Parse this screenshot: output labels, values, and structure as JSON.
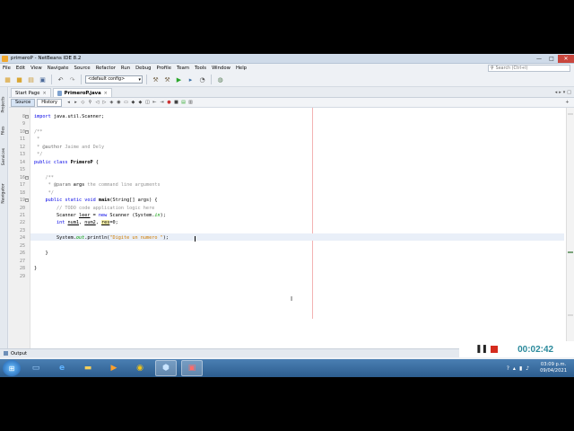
{
  "window": {
    "title": "primeroP - NetBeans IDE 8.2",
    "controls": [
      "—",
      "□",
      "✕"
    ]
  },
  "menu": {
    "items": [
      "File",
      "Edit",
      "View",
      "Navigate",
      "Source",
      "Refactor",
      "Run",
      "Debug",
      "Profile",
      "Team",
      "Tools",
      "Window",
      "Help"
    ],
    "search_placeholder": "Search (Ctrl+I)"
  },
  "toolbar": {
    "config_value": "<default config>"
  },
  "side_tabs": [
    "Projects",
    "Files",
    "Services",
    "Navigator"
  ],
  "file_tabs": [
    {
      "label": "Start Page",
      "active": false
    },
    {
      "label": "PrimeroP.java",
      "active": true
    }
  ],
  "editor_views": {
    "source": "Source",
    "history": "History"
  },
  "code": {
    "lines": [
      {
        "n": "8",
        "text": "import java.util.Scanner;"
      },
      {
        "n": "9",
        "text": ""
      },
      {
        "n": "10",
        "text": "/**"
      },
      {
        "n": "11",
        "text": " *"
      },
      {
        "n": "12",
        "text": " * @author Jaime and Dely"
      },
      {
        "n": "13",
        "text": " */"
      },
      {
        "n": "14",
        "text": "public class PrimeroP {"
      },
      {
        "n": "15",
        "text": ""
      },
      {
        "n": "16",
        "text": ""
      },
      {
        "n": "17",
        "text": "    /**"
      },
      {
        "n": "18",
        "text": "     * @param args the command line arguments"
      },
      {
        "n": "19",
        "text": "     */"
      },
      {
        "n": "19b",
        "text": "    public static void main(String[] args) {"
      },
      {
        "n": "20",
        "text": "        // TODO code application logic here"
      },
      {
        "n": "21",
        "text": "        Scanner leer = new Scanner (System.in);"
      },
      {
        "n": "22",
        "text": "        int num1, num2, res=0;"
      },
      {
        "n": "23",
        "text": ""
      },
      {
        "n": "24",
        "text": "        System.out.println(\"Digite un numero \");"
      },
      {
        "n": "25",
        "text": ""
      },
      {
        "n": "26",
        "text": "    }"
      },
      {
        "n": "27",
        "text": ""
      },
      {
        "n": "28",
        "text": "}"
      },
      {
        "n": "29",
        "text": ""
      }
    ],
    "gutter_numbers": [
      "8",
      "9",
      "10",
      "11",
      "12",
      "13",
      "14",
      "15",
      "16",
      "17",
      "18",
      "19",
      "20",
      "21",
      "22",
      "23",
      "24",
      "25",
      "26",
      "27",
      "28",
      "29"
    ]
  },
  "output_tab": "Output",
  "recorder": {
    "time": "00:02:42"
  },
  "taskbar": {
    "clock_time": "03:09 p.m.",
    "clock_date": "09/04/2021"
  }
}
